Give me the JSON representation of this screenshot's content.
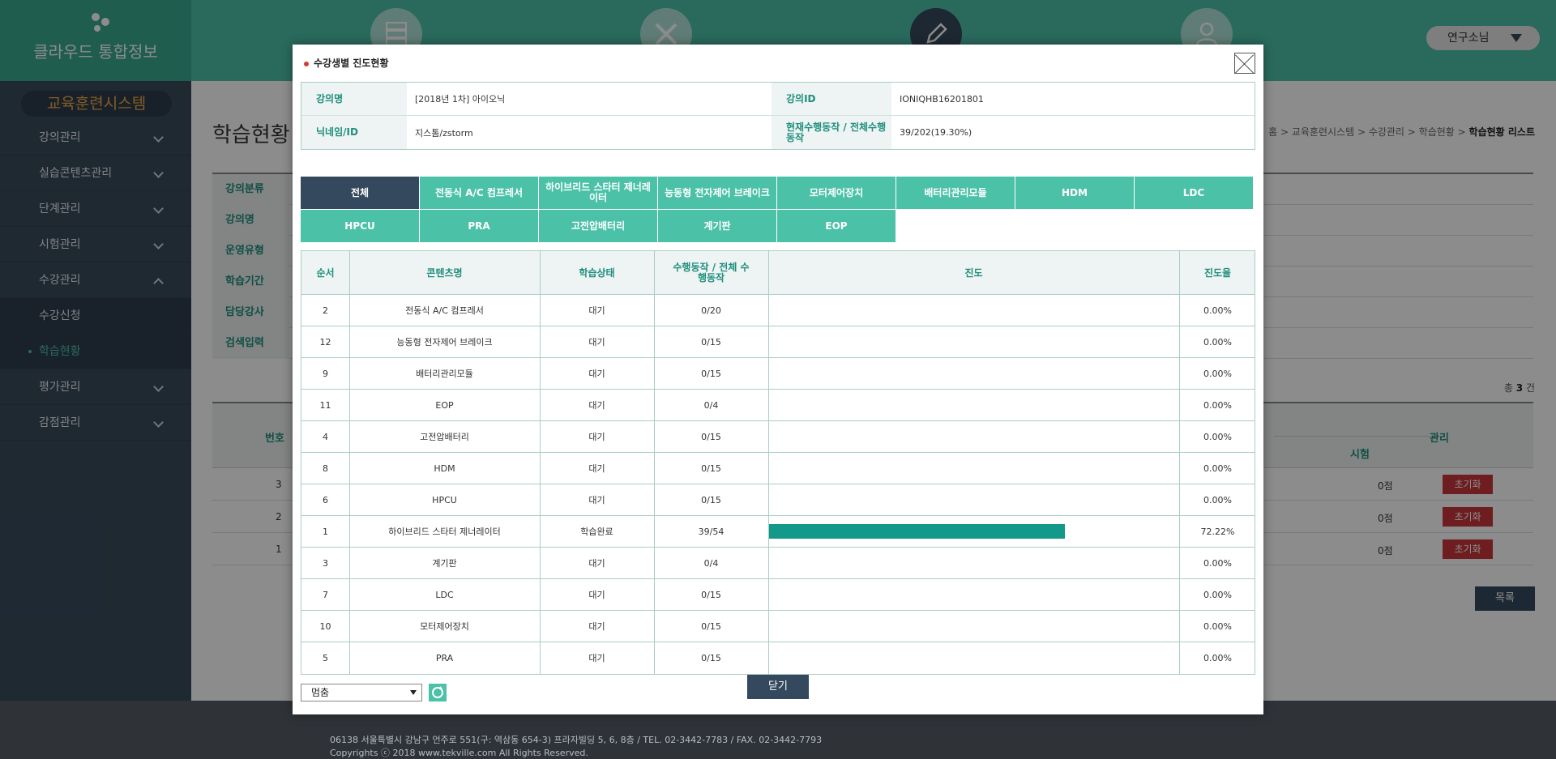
{
  "header": {
    "logo_text": "클라우드 통합정보",
    "user_label": "연구소님",
    "nav_icons": [
      "server-icon",
      "tools-icon",
      "pencil-icon",
      "user-icon"
    ]
  },
  "sidebar": {
    "system_title": "교육훈련시스템",
    "items": [
      {
        "label": "강의관리"
      },
      {
        "label": "실습콘텐츠관리"
      },
      {
        "label": "단계관리"
      },
      {
        "label": "시험관리"
      },
      {
        "label": "수강관리"
      },
      {
        "label": "수강신청"
      },
      {
        "label": "학습현황"
      },
      {
        "label": "평가관리"
      },
      {
        "label": "감점관리"
      }
    ]
  },
  "main": {
    "page_title": "학습현황",
    "breadcrumb": {
      "items": [
        "홈",
        "교육훈련시스템",
        "수강관리",
        "학습현황"
      ],
      "current": "학습현황 리스트"
    },
    "filters": [
      "강의분류",
      "강의명",
      "운영유형",
      "학습기간",
      "담당강사",
      "검색입력"
    ],
    "total_label": "총",
    "total_count": "3",
    "total_unit": "건",
    "list_headers": {
      "num": "번호",
      "exam": "시험",
      "manage": "관리"
    },
    "rows": [
      {
        "num": "3",
        "score": "0점",
        "action": "초기화"
      },
      {
        "num": "2",
        "score": "0점",
        "action": "초기화"
      },
      {
        "num": "1",
        "score": "0점",
        "action": "초기화"
      }
    ],
    "list_button": "목록"
  },
  "modal": {
    "title": "수강생별 진도현황",
    "info": {
      "course_label": "강의명",
      "course_value": "[2018년 1차] 아이오닉",
      "course_id_label": "강의ID",
      "course_id_value": "IONIQHB16201801",
      "nick_label": "닉네임/ID",
      "nick_value": "지스톰/zstorm",
      "progress_label": "현재수행동작 / 전체수행동작",
      "progress_value": "39/202(19.30%)"
    },
    "tabs": [
      "전체",
      "전동식 A/C 컴프레서",
      "하이브리드 스타터 제너레이터",
      "능동형 전자제어 브레이크",
      "모터제어장치",
      "배터리관리모듈",
      "HDM",
      "LDC",
      "HPCU",
      "PRA",
      "고전압배터리",
      "계기판",
      "EOP"
    ],
    "table_headers": {
      "order": "순서",
      "content": "콘텐츠명",
      "status": "학습상태",
      "actions": "수행동작 / 전체 수행동작",
      "progress": "진도",
      "rate": "진도율"
    },
    "rows": [
      {
        "order": "2",
        "content": "전동식 A/C 컴프레서",
        "status": "대기",
        "actions": "0/20",
        "progress": 0,
        "rate": "0.00%"
      },
      {
        "order": "12",
        "content": "능동형 전자제어 브레이크",
        "status": "대기",
        "actions": "0/15",
        "progress": 0,
        "rate": "0.00%"
      },
      {
        "order": "9",
        "content": "배터리관리모듈",
        "status": "대기",
        "actions": "0/15",
        "progress": 0,
        "rate": "0.00%"
      },
      {
        "order": "11",
        "content": "EOP",
        "status": "대기",
        "actions": "0/4",
        "progress": 0,
        "rate": "0.00%"
      },
      {
        "order": "4",
        "content": "고전압배터리",
        "status": "대기",
        "actions": "0/15",
        "progress": 0,
        "rate": "0.00%"
      },
      {
        "order": "8",
        "content": "HDM",
        "status": "대기",
        "actions": "0/15",
        "progress": 0,
        "rate": "0.00%"
      },
      {
        "order": "6",
        "content": "HPCU",
        "status": "대기",
        "actions": "0/15",
        "progress": 0,
        "rate": "0.00%"
      },
      {
        "order": "1",
        "content": "하이브리드 스타터 제너레이터",
        "status": "학습완료",
        "actions": "39/54",
        "progress": 0.7222,
        "rate": "72.22%"
      },
      {
        "order": "3",
        "content": "계기판",
        "status": "대기",
        "actions": "0/4",
        "progress": 0,
        "rate": "0.00%"
      },
      {
        "order": "7",
        "content": "LDC",
        "status": "대기",
        "actions": "0/15",
        "progress": 0,
        "rate": "0.00%"
      },
      {
        "order": "10",
        "content": "모터제어장치",
        "status": "대기",
        "actions": "0/15",
        "progress": 0,
        "rate": "0.00%"
      },
      {
        "order": "5",
        "content": "PRA",
        "status": "대기",
        "actions": "0/15",
        "progress": 0,
        "rate": "0.00%"
      }
    ],
    "sort_value": "멈춤",
    "close_button": "닫기"
  },
  "footer": {
    "address": "06138 서울특별시 강남구 언주로 551(구: 역삼동 654-3) 프라자빌딩 5, 6, 8층 / TEL. 02-3442-7783 / FAX. 02-3442-7793",
    "copyright": "Copyrights ⓒ 2018 www.tekville.com All Rights Reserved."
  },
  "colors": {
    "primary": "#4bc1a8",
    "dark": "#34495e",
    "progress_bar": "#12998a",
    "danger": "#c9383c"
  }
}
